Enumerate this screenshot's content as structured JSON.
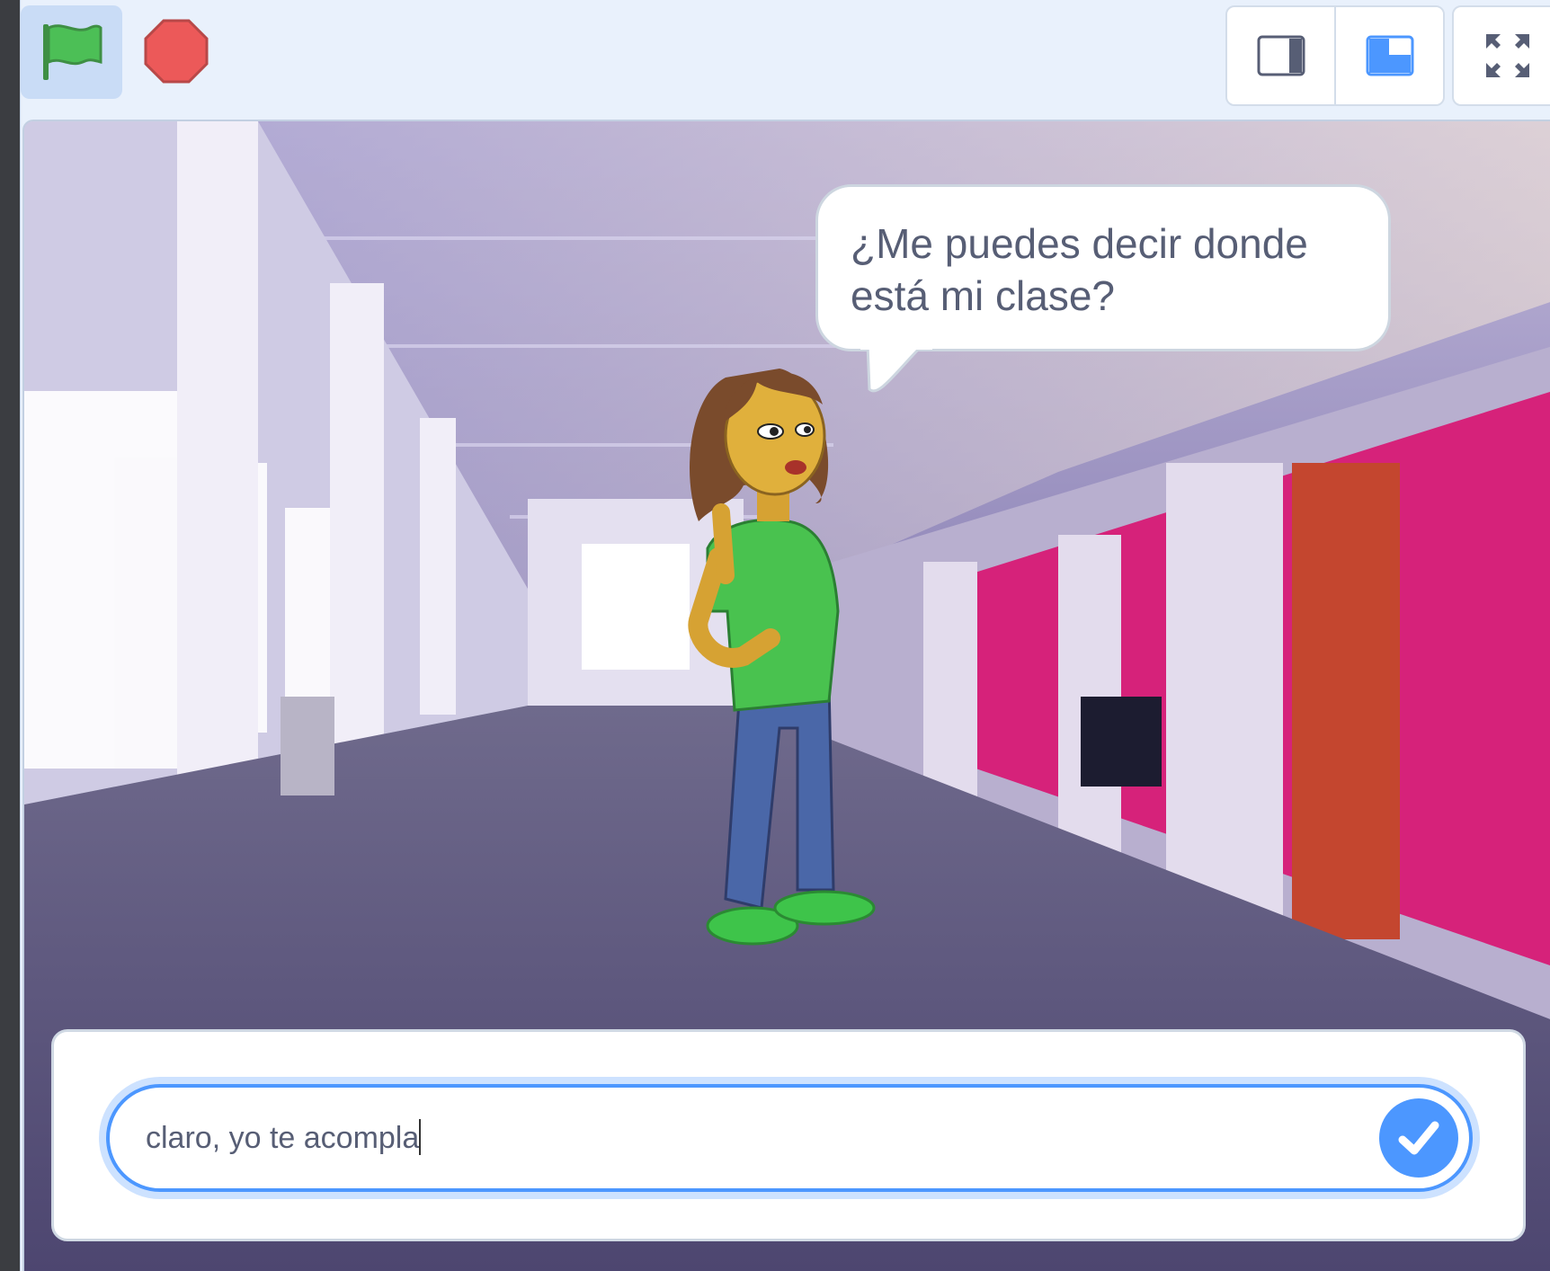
{
  "toolbar": {
    "green_flag_icon": "green-flag-icon",
    "stop_icon": "stop-sign-icon",
    "small_stage_icon": "small-stage-layout-icon",
    "normal_stage_icon": "normal-stage-layout-icon",
    "fullscreen_icon": "fullscreen-icon"
  },
  "stage": {
    "backdrop": "school-hallway",
    "sprite": "girl-character",
    "speech_bubble": {
      "line1": "¿Me puedes decir donde",
      "line2": "está mi clase?"
    },
    "ask_panel": {
      "answer_value": "claro, yo te acompla",
      "submit_icon": "checkmark-icon"
    }
  },
  "colors": {
    "accent": "#4c97ff",
    "flag_green": "#4cbf56",
    "stop_red": "#ec5959",
    "text": "#575e75",
    "hall_wall_magenta": "#d6227a",
    "floor": "#5a5376"
  }
}
